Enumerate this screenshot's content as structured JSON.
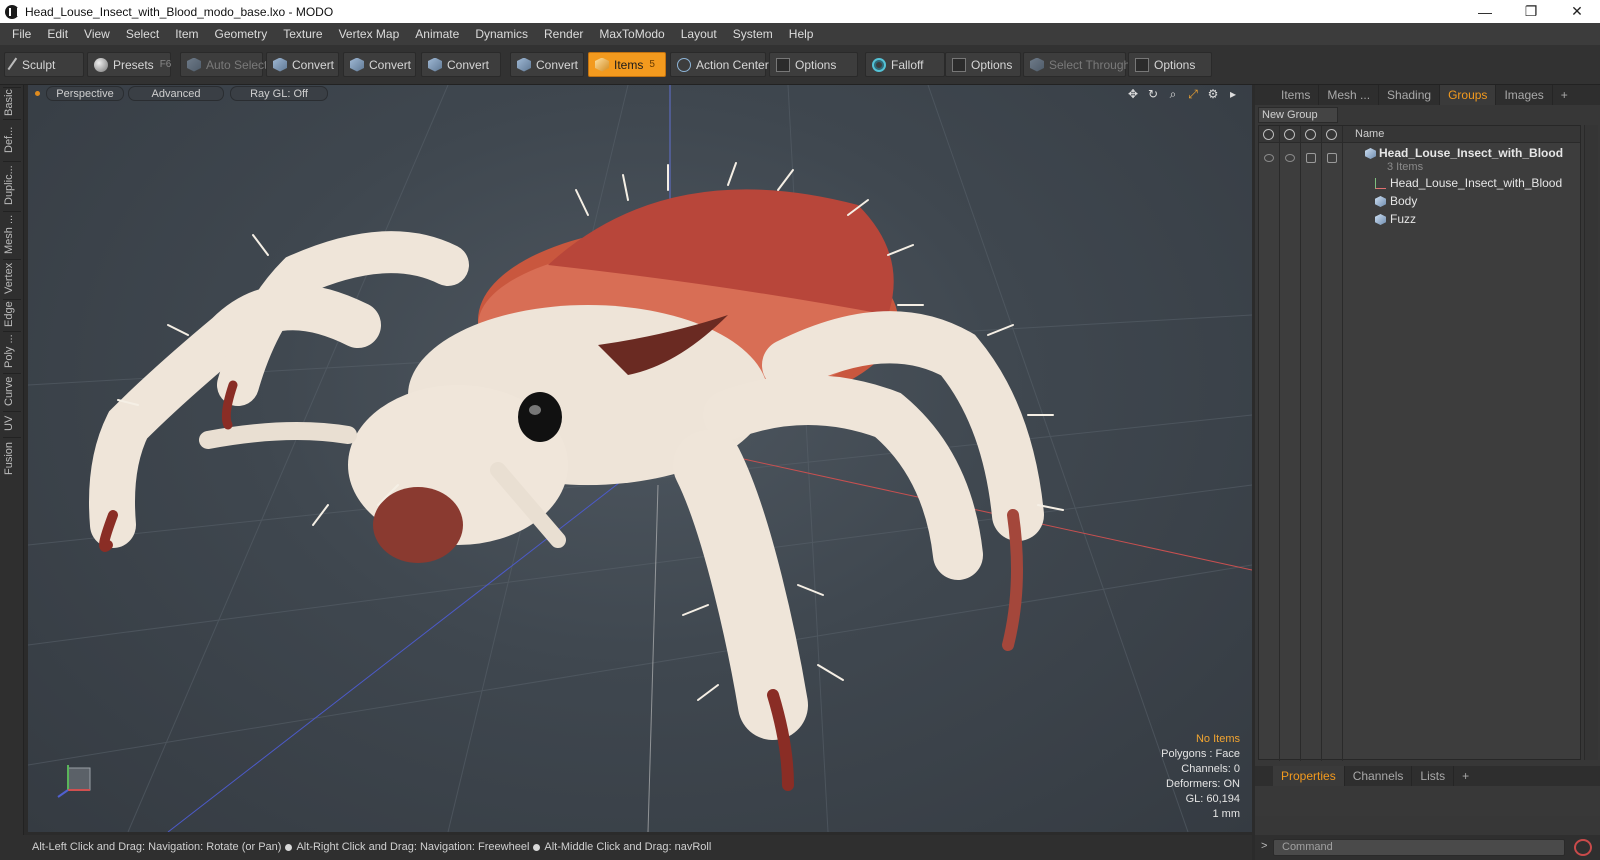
{
  "window": {
    "title": "Head_Louse_Insect_with_Blood_modo_base.lxo - MODO",
    "minimize": "—",
    "restore": "❐",
    "close": "✕"
  },
  "menu": [
    "File",
    "Edit",
    "View",
    "Select",
    "Item",
    "Geometry",
    "Texture",
    "Vertex Map",
    "Animate",
    "Dynamics",
    "Render",
    "MaxToModo",
    "Layout",
    "System",
    "Help"
  ],
  "toolbar": {
    "sculpt": "Sculpt",
    "presets": "Presets",
    "presets_hotkey": "F6",
    "auto_select": "Auto Select",
    "convert": "Convert",
    "items": "Items",
    "items_hotkey": "5",
    "action_center": "Action Center",
    "options": "Options",
    "falloff": "Falloff",
    "select_through": "Select Through"
  },
  "left_tabs": [
    "Basic",
    "Def...",
    "Duplic...",
    "Mesh ...",
    "Vertex",
    "Edge",
    "Poly ...",
    "Curve",
    "UV",
    "Fusion"
  ],
  "viewport": {
    "perspective": "Perspective",
    "advanced": "Advanced",
    "raygl": "Ray GL: Off",
    "info": {
      "no_items": "No Items",
      "polygons": "Polygons : Face",
      "channels": "Channels: 0",
      "deformers": "Deformers: ON",
      "gl": "GL: 60,194",
      "unit": "1 mm"
    }
  },
  "right_panel": {
    "tabs": [
      "Items",
      "Mesh ...",
      "Shading",
      "Groups",
      "Images"
    ],
    "active_tab": "Groups",
    "new_group": "New Group",
    "name_header": "Name",
    "tree": {
      "group": "Head_Louse_Insect_with_Blood",
      "group_count": "3 Items",
      "children": [
        "Head_Louse_Insect_with_Blood",
        "Body",
        "Fuzz"
      ]
    },
    "bottom_tabs": [
      "Properties",
      "Channels",
      "Lists"
    ],
    "active_bottom_tab": "Properties",
    "command_placeholder": "Command"
  },
  "status": {
    "hint1": "Alt-Left Click and Drag: Navigation: Rotate (or Pan)",
    "hint2": "Alt-Right Click and Drag: Navigation: Freewheel",
    "hint3": "Alt-Middle Click and Drag: navRoll"
  },
  "colors": {
    "accent": "#f39a1e",
    "viewport_bg": "#444c54"
  }
}
